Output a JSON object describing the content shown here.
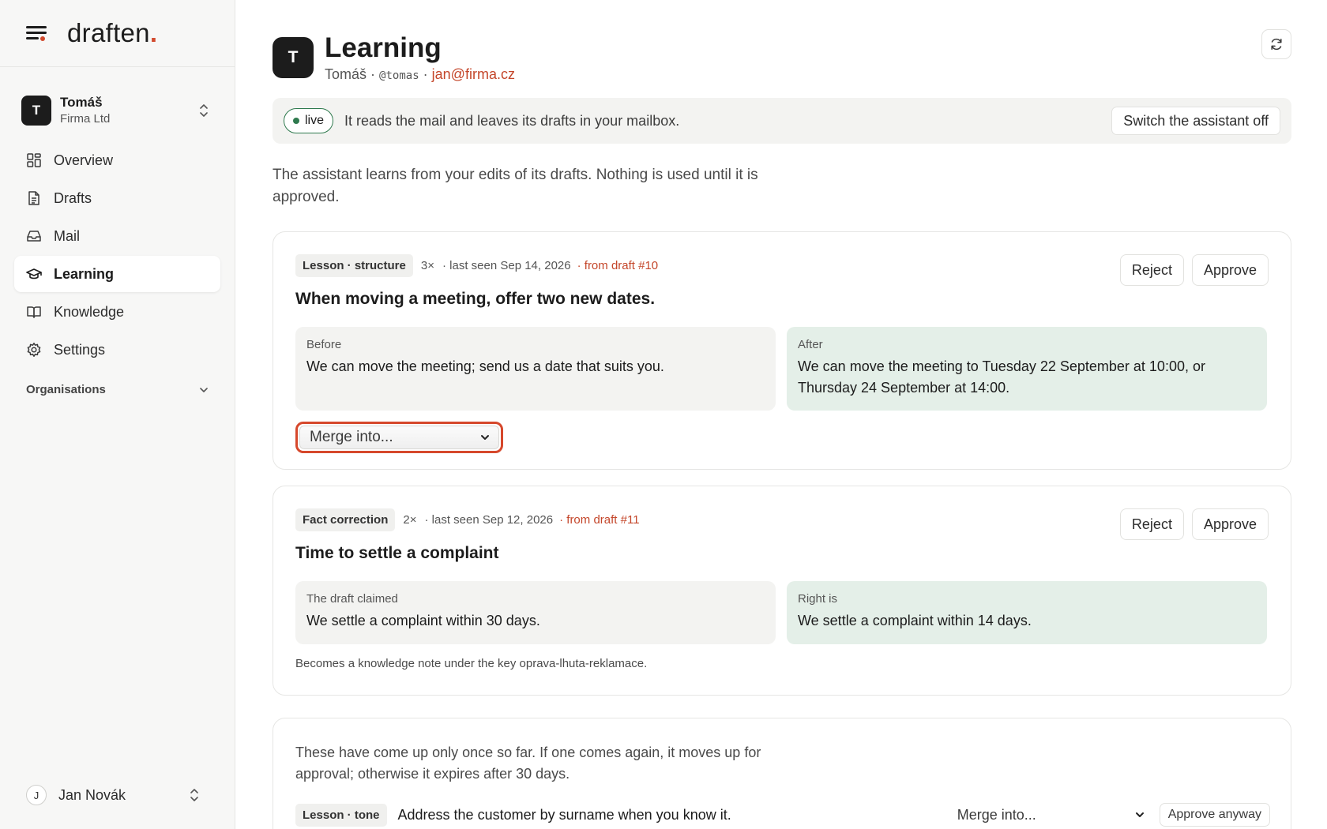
{
  "brand": {
    "name": "draften",
    "dot": "."
  },
  "account": {
    "initial": "T",
    "name": "Tomáš",
    "org": "Firma Ltd"
  },
  "nav": [
    {
      "label": "Overview",
      "icon": "grid-icon"
    },
    {
      "label": "Drafts",
      "icon": "document-icon"
    },
    {
      "label": "Mail",
      "icon": "inbox-icon"
    },
    {
      "label": "Learning",
      "icon": "graduation-cap-icon",
      "active": true
    },
    {
      "label": "Knowledge",
      "icon": "book-icon"
    },
    {
      "label": "Settings",
      "icon": "gear-icon"
    }
  ],
  "organisations_label": "Organisations",
  "user": {
    "initial": "J",
    "name": "Jan Novák"
  },
  "header": {
    "initial": "T",
    "title": "Learning",
    "name": "Tomáš",
    "handle": "@tomas",
    "email": "jan@firma.cz",
    "sep": "·"
  },
  "status": {
    "badge": "live",
    "text": "It reads the mail and leaves its drafts in your mailbox.",
    "switch_label": "Switch the assistant off",
    "live_color": "#2f7a4e"
  },
  "intro": "The assistant learns from your edits of its drafts. Nothing is used until it is approved.",
  "cards": [
    {
      "tag": "Lesson · structure",
      "count": "3×",
      "seen": "· last seen Sep 14, 2026",
      "draft": "· from draft #10",
      "title": "When moving a meeting, offer two new dates.",
      "reject": "Reject",
      "approve": "Approve",
      "left_label": "Before",
      "left_text": "We can move the meeting; send us a date that suits you.",
      "right_label": "After",
      "right_text": "We can move the meeting to Tuesday 22 September at 10:00, or Thursday 24 September at 14:00.",
      "merge": "Merge into..."
    },
    {
      "tag": "Fact correction",
      "count": "2×",
      "seen": "· last seen Sep 12, 2026",
      "draft": "· from draft #11",
      "title": "Time to settle a complaint",
      "reject": "Reject",
      "approve": "Approve",
      "left_label": "The draft claimed",
      "left_text": "We settle a complaint within 30 days.",
      "right_label": "Right is",
      "right_text": "We settle a complaint within 14 days.",
      "footnote": "Becomes a knowledge note under the key oprava-lhuta-reklamace."
    }
  ],
  "pending": {
    "text": "These have come up only once so far. If one comes again, it moves up for approval; otherwise it expires after 30 days.",
    "tag": "Lesson · tone",
    "title": "Address the customer by surname when you know it.",
    "merge": "Merge into...",
    "approve": "Approve anyway"
  },
  "colors": {
    "accent": "#c4462a",
    "highlight": "#d6482c",
    "after_bg": "#e4efe8"
  }
}
